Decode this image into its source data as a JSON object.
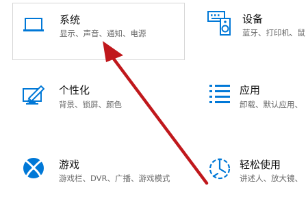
{
  "settings": {
    "accent_color": "#0078d7",
    "tiles": [
      {
        "id": "system",
        "icon": "laptop-icon",
        "title": "系统",
        "description": "显示、声音、通知、电源"
      },
      {
        "id": "devices",
        "icon": "devices-icon",
        "title": "设备",
        "description": "蓝牙、打印机、鼠"
      },
      {
        "id": "personalization",
        "icon": "personalization-icon",
        "title": "个性化",
        "description": "背景、锁屏、颜色"
      },
      {
        "id": "apps",
        "icon": "apps-list-icon",
        "title": "应用",
        "description": "卸载、默认应用、"
      },
      {
        "id": "gaming",
        "icon": "xbox-icon",
        "title": "游戏",
        "description": "游戏栏、DVR、广播、游戏模式"
      },
      {
        "id": "ease-of-access",
        "icon": "ease-of-access-icon",
        "title": "轻松使用",
        "description": "讲述人、放大镜、"
      }
    ]
  },
  "annotation": {
    "arrow_color": "#c0181c",
    "arrow_icon": "red-arrow-pointing-up-left"
  }
}
